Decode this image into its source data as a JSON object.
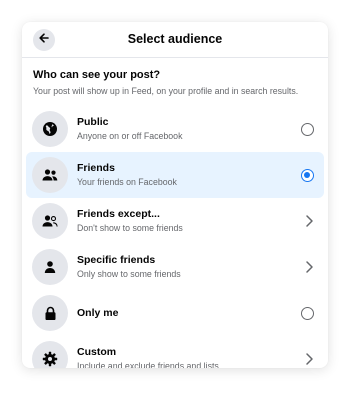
{
  "header": {
    "title": "Select audience",
    "back_icon": "arrow-left-icon"
  },
  "intro": {
    "question": "Who can see your post?",
    "subtitle": "Your post will show up in Feed, on your profile and in search results."
  },
  "options": [
    {
      "label": "Public",
      "description": "Anyone on or off Facebook",
      "icon": "globe-icon",
      "control": "radio",
      "selected": false
    },
    {
      "label": "Friends",
      "description": "Your friends on Facebook",
      "icon": "friends-icon",
      "control": "radio",
      "selected": true
    },
    {
      "label": "Friends except...",
      "description": "Don't show to some friends",
      "icon": "friends-except-icon",
      "control": "chevron",
      "selected": false
    },
    {
      "label": "Specific friends",
      "description": "Only show to some friends",
      "icon": "person-icon",
      "control": "chevron",
      "selected": false
    },
    {
      "label": "Only me",
      "description": "",
      "icon": "lock-icon",
      "control": "radio",
      "selected": false
    },
    {
      "label": "Custom",
      "description": "Include and exclude friends and lists",
      "icon": "gear-icon",
      "control": "chevron",
      "selected": false
    }
  ],
  "colors": {
    "accent": "#1877f2",
    "selected_bg": "#e7f3ff",
    "icon_bg": "#e4e6eb",
    "secondary_text": "#65676b"
  }
}
